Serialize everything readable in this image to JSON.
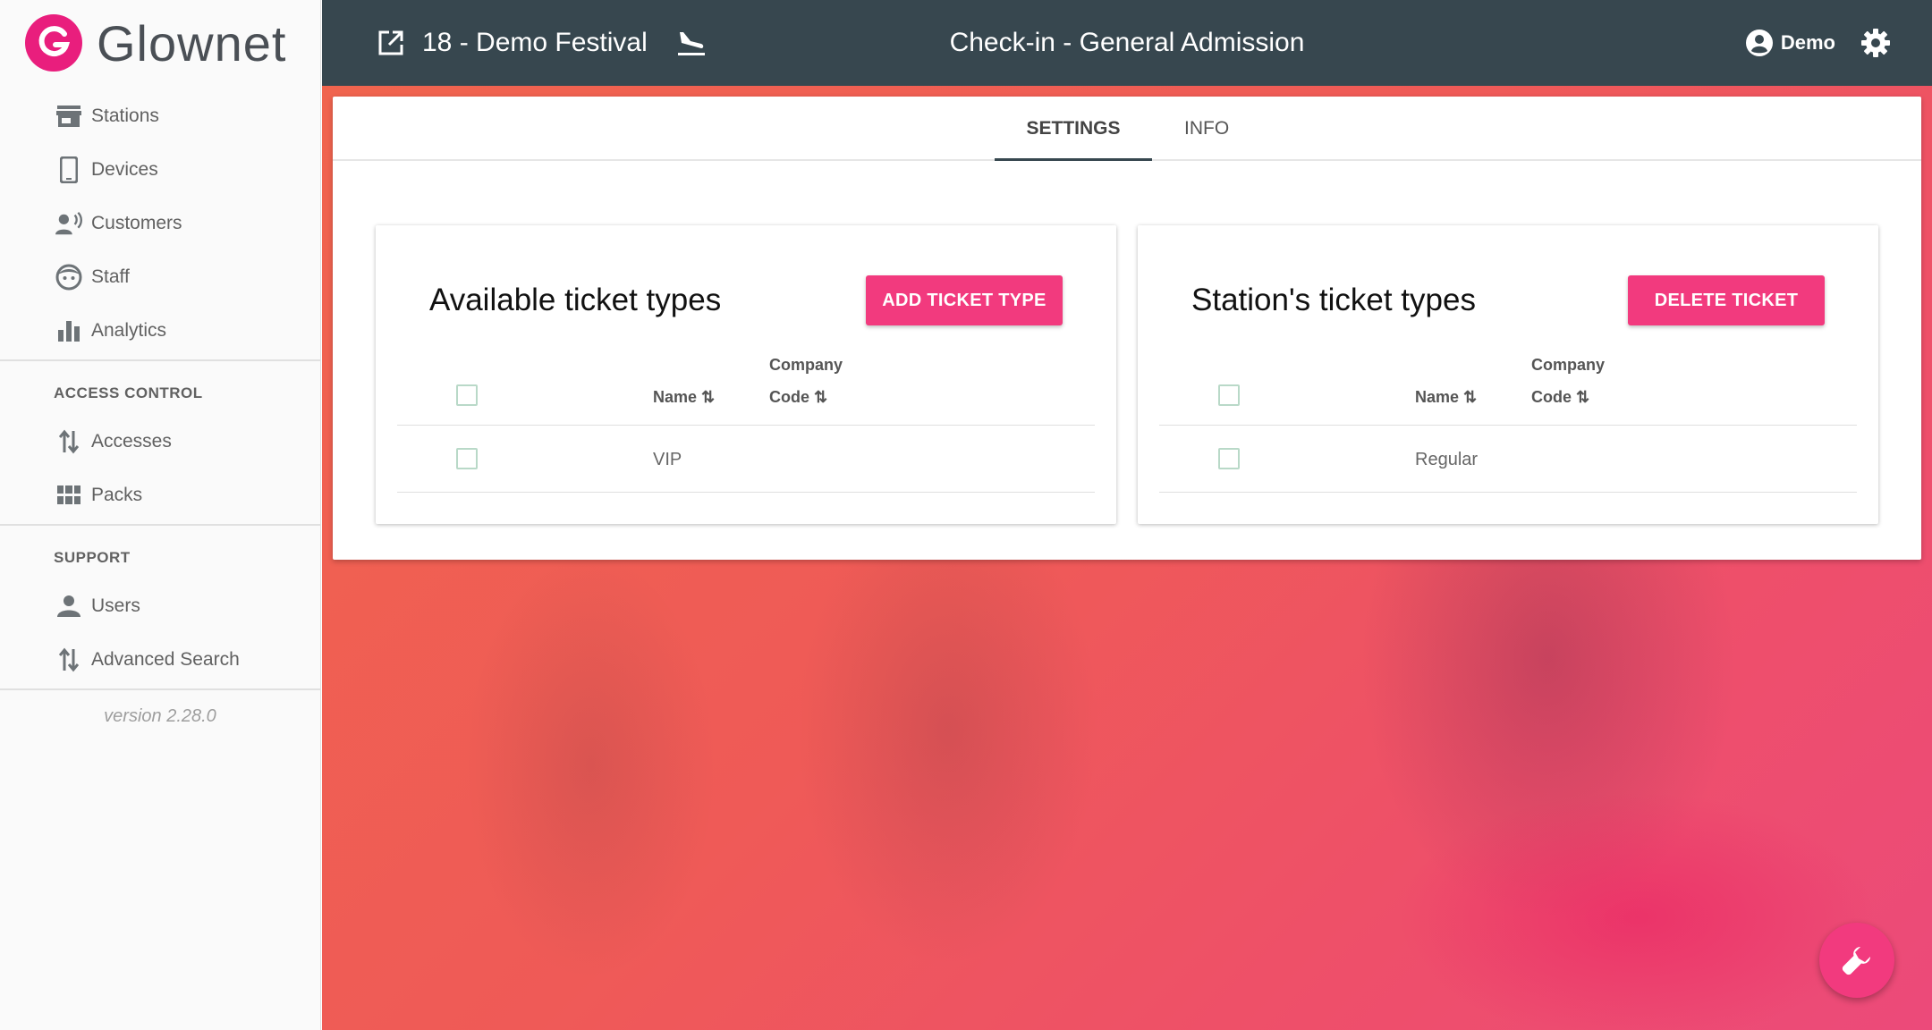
{
  "brand": {
    "name": "Glownet"
  },
  "sidebar": {
    "main_items": [
      {
        "label": "Stations",
        "icon": "store-icon"
      },
      {
        "label": "Devices",
        "icon": "phone-icon"
      },
      {
        "label": "Customers",
        "icon": "customer-voice-icon"
      },
      {
        "label": "Staff",
        "icon": "face-icon"
      },
      {
        "label": "Analytics",
        "icon": "bar-chart-icon"
      }
    ],
    "access_control": {
      "title": "ACCESS CONTROL",
      "items": [
        {
          "label": "Accesses",
          "icon": "swap-vertical-icon"
        },
        {
          "label": "Packs",
          "icon": "grid-icon"
        }
      ]
    },
    "support": {
      "title": "SUPPORT",
      "items": [
        {
          "label": "Users",
          "icon": "person-icon"
        },
        {
          "label": "Advanced Search",
          "icon": "swap-vertical-icon"
        }
      ]
    },
    "version": "version 2.28.0"
  },
  "topbar": {
    "event_title": "18 - Demo Festival",
    "page_title": "Check-in - General Admission",
    "user_name": "Demo",
    "colors": {
      "background": "#37474f"
    }
  },
  "tabs": [
    {
      "label": "SETTINGS",
      "active": true
    },
    {
      "label": "INFO",
      "active": false
    }
  ],
  "available_panel": {
    "title": "Available ticket types",
    "button_label": "ADD TICKET TYPE",
    "columns": {
      "name": "Name ⇅",
      "company_line1": "Company",
      "company_line2": "Code ⇅"
    },
    "rows": [
      {
        "name": "VIP",
        "company_code": ""
      }
    ]
  },
  "station_panel": {
    "title": "Station's ticket types",
    "button_label": "DELETE TICKET",
    "columns": {
      "name": "Name ⇅",
      "company_line1": "Company",
      "company_line2": "Code ⇅"
    },
    "rows": [
      {
        "name": "Regular",
        "company_code": ""
      }
    ]
  },
  "theme": {
    "accent": "#f23a7e",
    "brand": "#e91e7d"
  },
  "fab": {
    "icon": "wrench-icon"
  }
}
